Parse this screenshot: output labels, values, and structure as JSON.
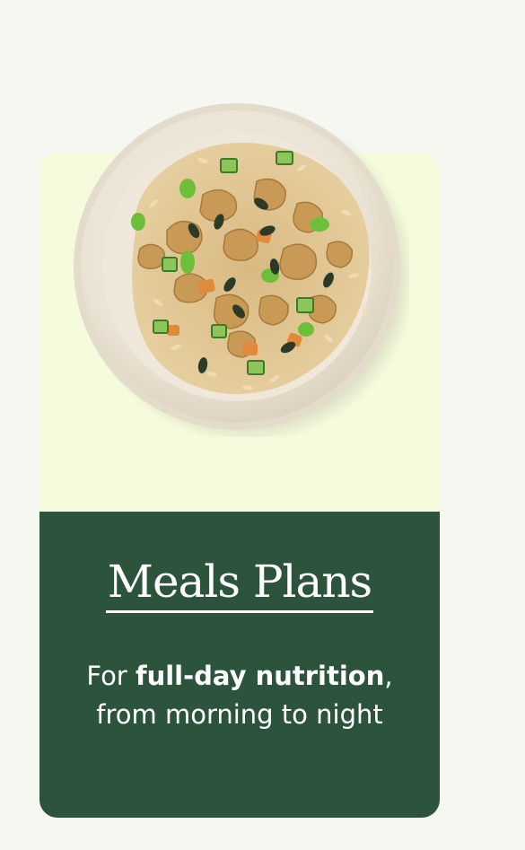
{
  "card": {
    "title": "Meals Plans",
    "subtitle": {
      "part1": "For ",
      "bold1": "full-day nutrition",
      "part2": ", from morning to night"
    }
  },
  "image": {
    "subject": "bowl-of-curry-with-rice-icon"
  },
  "colors": {
    "page_bg": "#f7f7f2",
    "card_top_bg": "#f6fbdd",
    "card_bottom_bg": "#2c543c",
    "text": "#ffffff"
  }
}
